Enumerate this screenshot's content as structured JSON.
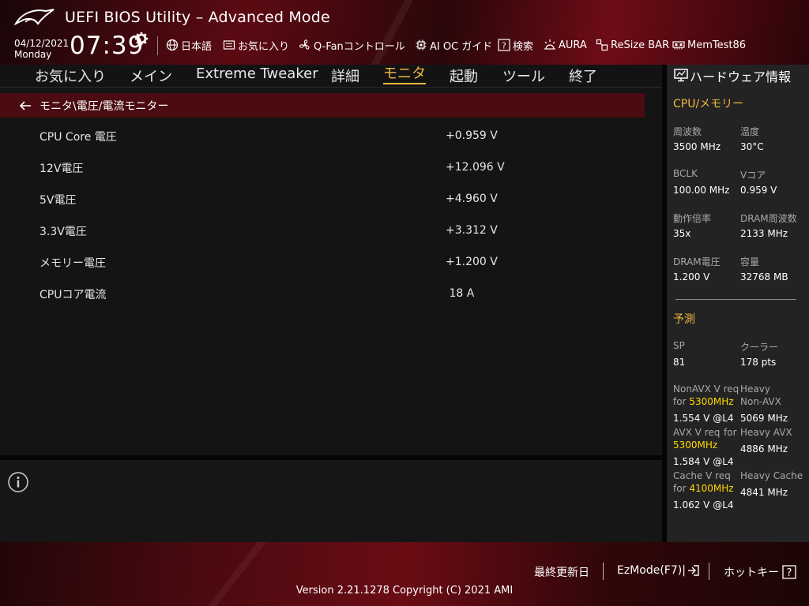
{
  "header": {
    "app_title": "UEFI BIOS Utility – Advanced Mode",
    "date": "04/12/2021",
    "weekday": "Monday",
    "time": "07:39",
    "tools": [
      {
        "label": "日本語",
        "icon": "globe-icon"
      },
      {
        "label": "お気に入り",
        "icon": "favorites-icon"
      },
      {
        "label": "Q-Fanコントロール",
        "icon": "fan-icon"
      },
      {
        "label": "AI OC ガイド",
        "icon": "ai-oc-icon"
      },
      {
        "label": "検索",
        "icon": "search-help-icon"
      },
      {
        "label": "AURA",
        "icon": "aura-icon"
      },
      {
        "label": "ReSize BAR",
        "icon": "resize-bar-icon"
      },
      {
        "label": "MemTest86",
        "icon": "memtest-icon"
      }
    ]
  },
  "nav": {
    "tabs": [
      {
        "label": "お気に入り"
      },
      {
        "label": "メイン"
      },
      {
        "label": "Extreme Tweaker"
      },
      {
        "label": "詳細"
      },
      {
        "label": "モニタ"
      },
      {
        "label": "起動"
      },
      {
        "label": "ツール"
      },
      {
        "label": "終了"
      }
    ],
    "active": "モニタ"
  },
  "main": {
    "breadcrumb": "モニタ\\電圧/電流モニター",
    "rows": [
      {
        "label": "CPU Core 電圧",
        "value": "+0.959 V"
      },
      {
        "label": "12V電圧",
        "value": "+12.096 V"
      },
      {
        "label": "5V電圧",
        "value": "+4.960 V"
      },
      {
        "label": "3.3V電圧",
        "value": "+3.312 V"
      },
      {
        "label": "メモリー電圧",
        "value": "+1.200 V"
      },
      {
        "label": "CPUコア電流",
        "value": " 18 A"
      }
    ]
  },
  "panel": {
    "title": "ハードウェア情報",
    "cpu_section": "CPU/メモリー",
    "cpu": [
      {
        "label": "周波数",
        "value": "3500 MHz"
      },
      {
        "label": "温度",
        "value": "30°C"
      },
      {
        "label": "BCLK",
        "value": "100.00 MHz"
      },
      {
        "label": "Vコア",
        "value": "0.959 V"
      },
      {
        "label": "動作倍率",
        "value": "35x"
      },
      {
        "label": "DRAM周波数",
        "value": "2133 MHz"
      },
      {
        "label": "DRAM電圧",
        "value": "1.200 V"
      },
      {
        "label": "容量",
        "value": "32768 MB"
      }
    ],
    "predict_section": "予測",
    "sp_label": "SP",
    "sp_value": "81",
    "cooler_label": "クーラー",
    "cooler_value": "178 pts",
    "nonavx": {
      "label": "NonAVX V req",
      "for": "for",
      "freq": "5300MHz",
      "value": "1.554 V @L4"
    },
    "heavy_nonavx": {
      "label1": "Heavy",
      "label2": "Non-AVX",
      "value": "5069 MHz"
    },
    "avx": {
      "label": "AVX V req",
      "for": "for",
      "freq": "5300MHz",
      "value": "1.584 V @L4"
    },
    "heavy_avx": {
      "label": "Heavy AVX",
      "value": "4886 MHz"
    },
    "cache": {
      "label": "Cache V req",
      "for": "for",
      "freq": "4100MHz",
      "value": "1.062 V @L4"
    },
    "heavy_cache": {
      "label": "Heavy Cache",
      "value": "4841 MHz"
    }
  },
  "footer": {
    "last_modified": "最終更新日",
    "ezmode": "EzMode(F7)|",
    "hotkeys": "ホットキー",
    "version": "Version 2.21.1278 Copyright (C) 2021 AMI"
  },
  "colors": {
    "accent": "#f0b640",
    "highlight": "#ffd800",
    "breadcrumb_bg": "#4a0c10"
  }
}
